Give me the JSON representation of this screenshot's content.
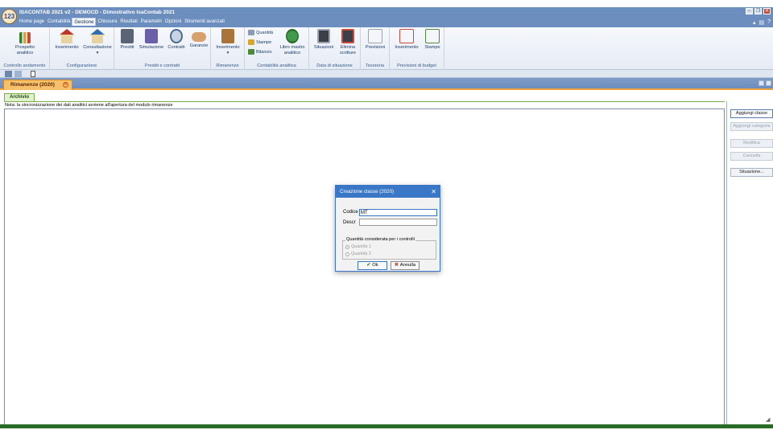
{
  "app": {
    "title": "ISACONTAB 2021 v2 - DEMOCD - Dimostrativo IsaContab 2021",
    "logo_text": "123"
  },
  "menu": [
    {
      "label": "Home page",
      "active": false
    },
    {
      "label": "Contabilità",
      "active": false
    },
    {
      "label": "Gestione",
      "active": true
    },
    {
      "label": "Chiusura",
      "active": false
    },
    {
      "label": "Risultati",
      "active": false
    },
    {
      "label": "Parametri",
      "active": false
    },
    {
      "label": "Opzioni",
      "active": false
    },
    {
      "label": "Strumenti avanzati",
      "active": false
    }
  ],
  "ribbon": {
    "groups": {
      "controllo": "Controllo andamento",
      "configurazione": "Configurazione",
      "prestiti": "Prestiti e contratti",
      "rimanenze": "Rimanenze",
      "analitica": "Contabilità analitica",
      "data_situazione": "Data di situazione",
      "tesoreria": "Tesoreria",
      "previsioni_budget": "Previsioni di budget"
    },
    "buttons": {
      "prospetto": "Prospetto analitico",
      "inserimento_conf": "Inserimento",
      "consultazione": "Consultazione",
      "prestiti": "Prestiti",
      "simulazione": "Simulazione",
      "contratti": "Contratti",
      "garanzie": "Garanzie",
      "inserimento_rim": "Inserimento",
      "quantita": "Quantità",
      "stampe": "Stampe",
      "bilancio": "Bilancio",
      "libro_mastro": "Libro mastro analitico",
      "situazioni": "Situazioni",
      "elimina_scritture": "Elimina scritture",
      "previsioni": "Previsioni",
      "inserimento_bud": "Inserimento",
      "stampe_bud": "Stampe"
    }
  },
  "document_tab": {
    "label": "Rimanenze (2020)"
  },
  "subtab": {
    "label": "Archivio"
  },
  "note": "Nota: la sincronizzazione dei dati analitici avviene all'apertura del modulo rimanenze",
  "side_buttons": {
    "aggiungi_classe": "Aggiungi classe",
    "aggiungi_categoria": "Aggiungi categoria",
    "modifica": "Modifica",
    "cancella": "Cancella",
    "situazione": "Situazione..."
  },
  "dialog": {
    "title": "Creazione classe (2020)",
    "codice_label": "Codice",
    "codice_value": "MT",
    "descr_label": "Descr",
    "descr_value": "",
    "qty_legend": "Quantità considerata per i controlli",
    "qty_option_1": "Quantità 1",
    "qty_option_2": "Quantità 2",
    "qty_selected": "Quantità 1",
    "ok_label": "Ok",
    "cancel_label": "Annulla"
  },
  "colors": {
    "title_bar": "#6c8ebf",
    "dialog_accent": "#3a78c7",
    "tab_accent": "#f7c06b",
    "status_bar": "#2a6b2a"
  }
}
